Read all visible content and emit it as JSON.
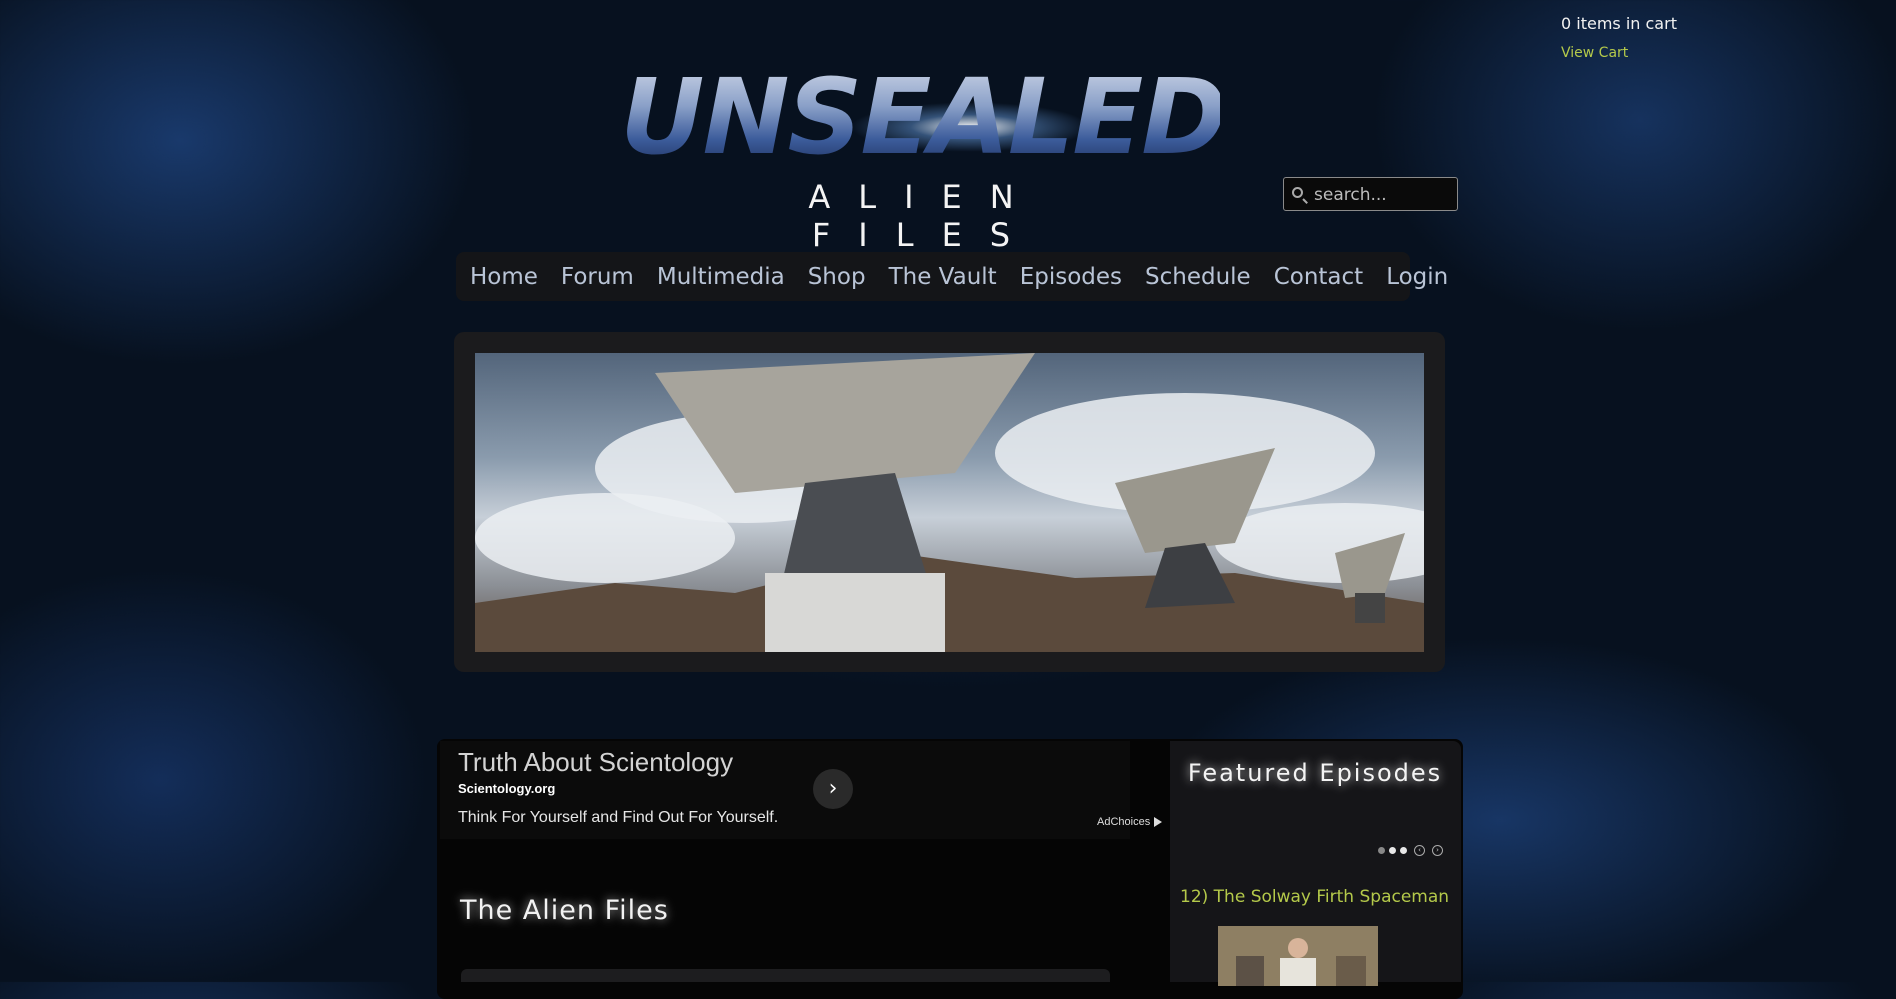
{
  "cart": {
    "count_text": "0 items in cart",
    "view_cart": "View Cart"
  },
  "logo": {
    "title": "UNSEALED",
    "subtitle": "ALIEN FILES"
  },
  "search": {
    "placeholder": "search..."
  },
  "nav": {
    "items": [
      "Home",
      "Forum",
      "Multimedia",
      "Shop",
      "The Vault",
      "Episodes",
      "Schedule",
      "Contact",
      "Login"
    ]
  },
  "ad": {
    "title": "Truth About Scientology",
    "domain": "Scientology.org",
    "text": "Think For Yourself and Find Out For Yourself.",
    "adchoices": "AdChoices"
  },
  "main": {
    "heading": "The Alien Files"
  },
  "featured": {
    "title": "Featured Episodes",
    "slider": {
      "dots": 3,
      "active_dots": [
        1,
        2
      ]
    },
    "episode_title": "12) The Solway Firth Spaceman"
  },
  "colors": {
    "accent_link": "#b4c94a",
    "nav_text": "#b9c4d6",
    "background": "#07111f"
  },
  "icons": {
    "search": "search-icon",
    "ad_arrow": "chevron-right-icon",
    "adchoices": "adchoices-icon",
    "slider_prev": "circle-left-icon",
    "slider_next": "circle-right-icon"
  }
}
